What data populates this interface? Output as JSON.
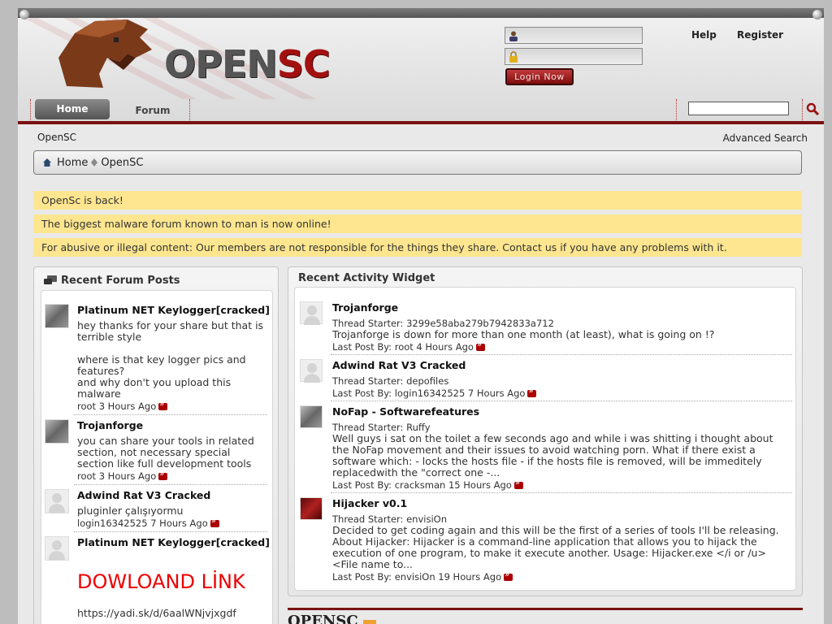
{
  "header": {
    "logo_open": "OPEN",
    "logo_sc": "SC",
    "login_button": "Login Now",
    "help_link": "Help",
    "register_link": "Register"
  },
  "nav": {
    "tabs": [
      {
        "label": "Home",
        "active": true
      },
      {
        "label": "Forum",
        "active": false
      }
    ]
  },
  "crumb_top": "OpenSC",
  "advanced_search": "Advanced Search",
  "breadcrumb": {
    "home": "Home",
    "current": "OpenSC"
  },
  "notices": [
    "OpenSc is back!",
    "The biggest malware forum known to man is now online!",
    "For abusive or illegal content: Our members are not responsible for the things they share. Contact us if you have any problems with it."
  ],
  "recent_posts": {
    "title": "Recent Forum Posts",
    "posts": [
      {
        "title": "Platinum NET Keylogger[cracked]",
        "text": [
          "hey thanks for your share but that is",
          "terrible style",
          "",
          "where is that key logger pics and",
          "features?",
          "and why don't you upload this",
          "malware"
        ],
        "meta": "root 3 Hours Ago"
      },
      {
        "title": "Trojanforge",
        "text": [
          "you can share your tools in related",
          "section, not necessary special",
          "section like full development tools"
        ],
        "meta": "root 3 Hours Ago"
      },
      {
        "title": "Adwind Rat V3 Cracked",
        "text": [
          "pluginler çalışıyormu"
        ],
        "meta": "login16342525 7 Hours Ago"
      },
      {
        "title": "Platinum NET Keylogger[cracked]",
        "download": "DOWLOAND LİNK",
        "link": "https://yadi.sk/d/6aalWNjvjxgdf"
      }
    ]
  },
  "activity": {
    "title": "Recent Activity Widget",
    "items": [
      {
        "title": "Trojanforge",
        "starter_label": "Thread Starter:",
        "starter": "3299e58aba279b7942833a712",
        "body": [
          "Trojanforge is down for more than one month (at least), what is going on !?"
        ],
        "last_label": "Last Post By:",
        "last": "root 4 Hours Ago"
      },
      {
        "title": "Adwind Rat V3 Cracked",
        "starter_label": "Thread Starter:",
        "starter": "depofiles",
        "body": [],
        "last_label": "Last Post By:",
        "last": "login16342525 7 Hours Ago"
      },
      {
        "title": "NoFap - Softwarefeatures",
        "starter_label": "Thread Starter:",
        "starter": "Ruffy",
        "body": [
          "Well guys i sat on the toilet a few seconds ago and while i was shitting i thought about",
          "the NoFap movement and their issues to avoid watching porn. What if there exist a",
          "software which: - locks the hosts file - if the hosts file is removed, will be immeditely",
          "replacedwith the \"correct one -..."
        ],
        "last_label": "Last Post By:",
        "last": "cracksman 15 Hours Ago"
      },
      {
        "title": "Hijacker v0.1",
        "starter_label": "Thread Starter:",
        "starter": "envisiOn",
        "body": [
          "Decided to get coding again and this will be the first of a series of tools I'll be releasing.",
          "About Hijacker: Hijacker is a command-line application that allows you to hijack the",
          "execution of one program, to make it execute another. Usage: Hijacker.exe </i or /u>",
          "<File name to..."
        ],
        "last_label": "Last Post By:",
        "last": "envisiOn 19 Hours Ago"
      }
    ]
  },
  "bottom_title": "OPENSC",
  "colors": {
    "accent": "#7a1212",
    "notice_bg": "#fde68f",
    "download": "#ee0000"
  }
}
